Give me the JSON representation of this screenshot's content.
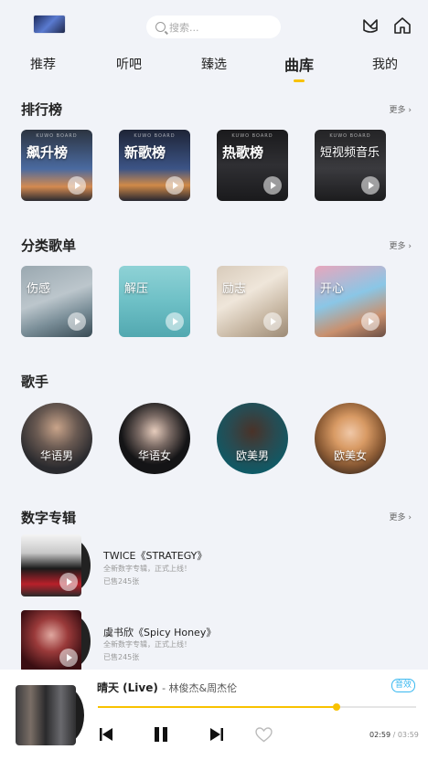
{
  "header": {
    "search_placeholder": "搜索...",
    "icons": [
      "avatar",
      "headset-icon",
      "home-icon"
    ]
  },
  "tabs": [
    {
      "label": "推荐",
      "active": false
    },
    {
      "label": "听吧",
      "active": false
    },
    {
      "label": "臻选",
      "active": false
    },
    {
      "label": "曲库",
      "active": true
    },
    {
      "label": "我的",
      "active": false
    }
  ],
  "charts": {
    "title": "排行榜",
    "more": "更多",
    "items": [
      {
        "label": "飙升榜",
        "sub": "KUWO BOARD"
      },
      {
        "label": "新歌榜",
        "sub": "KUWO BOARD"
      },
      {
        "label": "热歌榜",
        "sub": "KUWO BOARD"
      },
      {
        "label": "短视频音乐",
        "sub": "KUWO BOARD"
      }
    ]
  },
  "playlists": {
    "title": "分类歌单",
    "more": "更多",
    "items": [
      {
        "label": "伤感"
      },
      {
        "label": "解压"
      },
      {
        "label": "励志"
      },
      {
        "label": "开心"
      }
    ]
  },
  "singers": {
    "title": "歌手",
    "items": [
      {
        "label": "华语男"
      },
      {
        "label": "华语女"
      },
      {
        "label": "欧美男"
      },
      {
        "label": "欧美女"
      }
    ]
  },
  "albums": {
    "title": "数字专辑",
    "more": "更多",
    "items": [
      {
        "title": "TWICE《STRATEGY》",
        "desc": "全新数字专辑，正式上线！",
        "sold": "已售245张"
      },
      {
        "title": "虞书欣《Spicy Honey》",
        "desc": "全新数字专辑，正式上线！",
        "sold": "已售245张"
      }
    ]
  },
  "player": {
    "song": "晴天 (Live)",
    "artist": "林俊杰&周杰伦",
    "quality": "音效",
    "progress": 0.75,
    "current": "02:59",
    "duration": "03:59",
    "colors": {
      "accent": "#f8c200",
      "quality": "#39b8f0"
    }
  }
}
